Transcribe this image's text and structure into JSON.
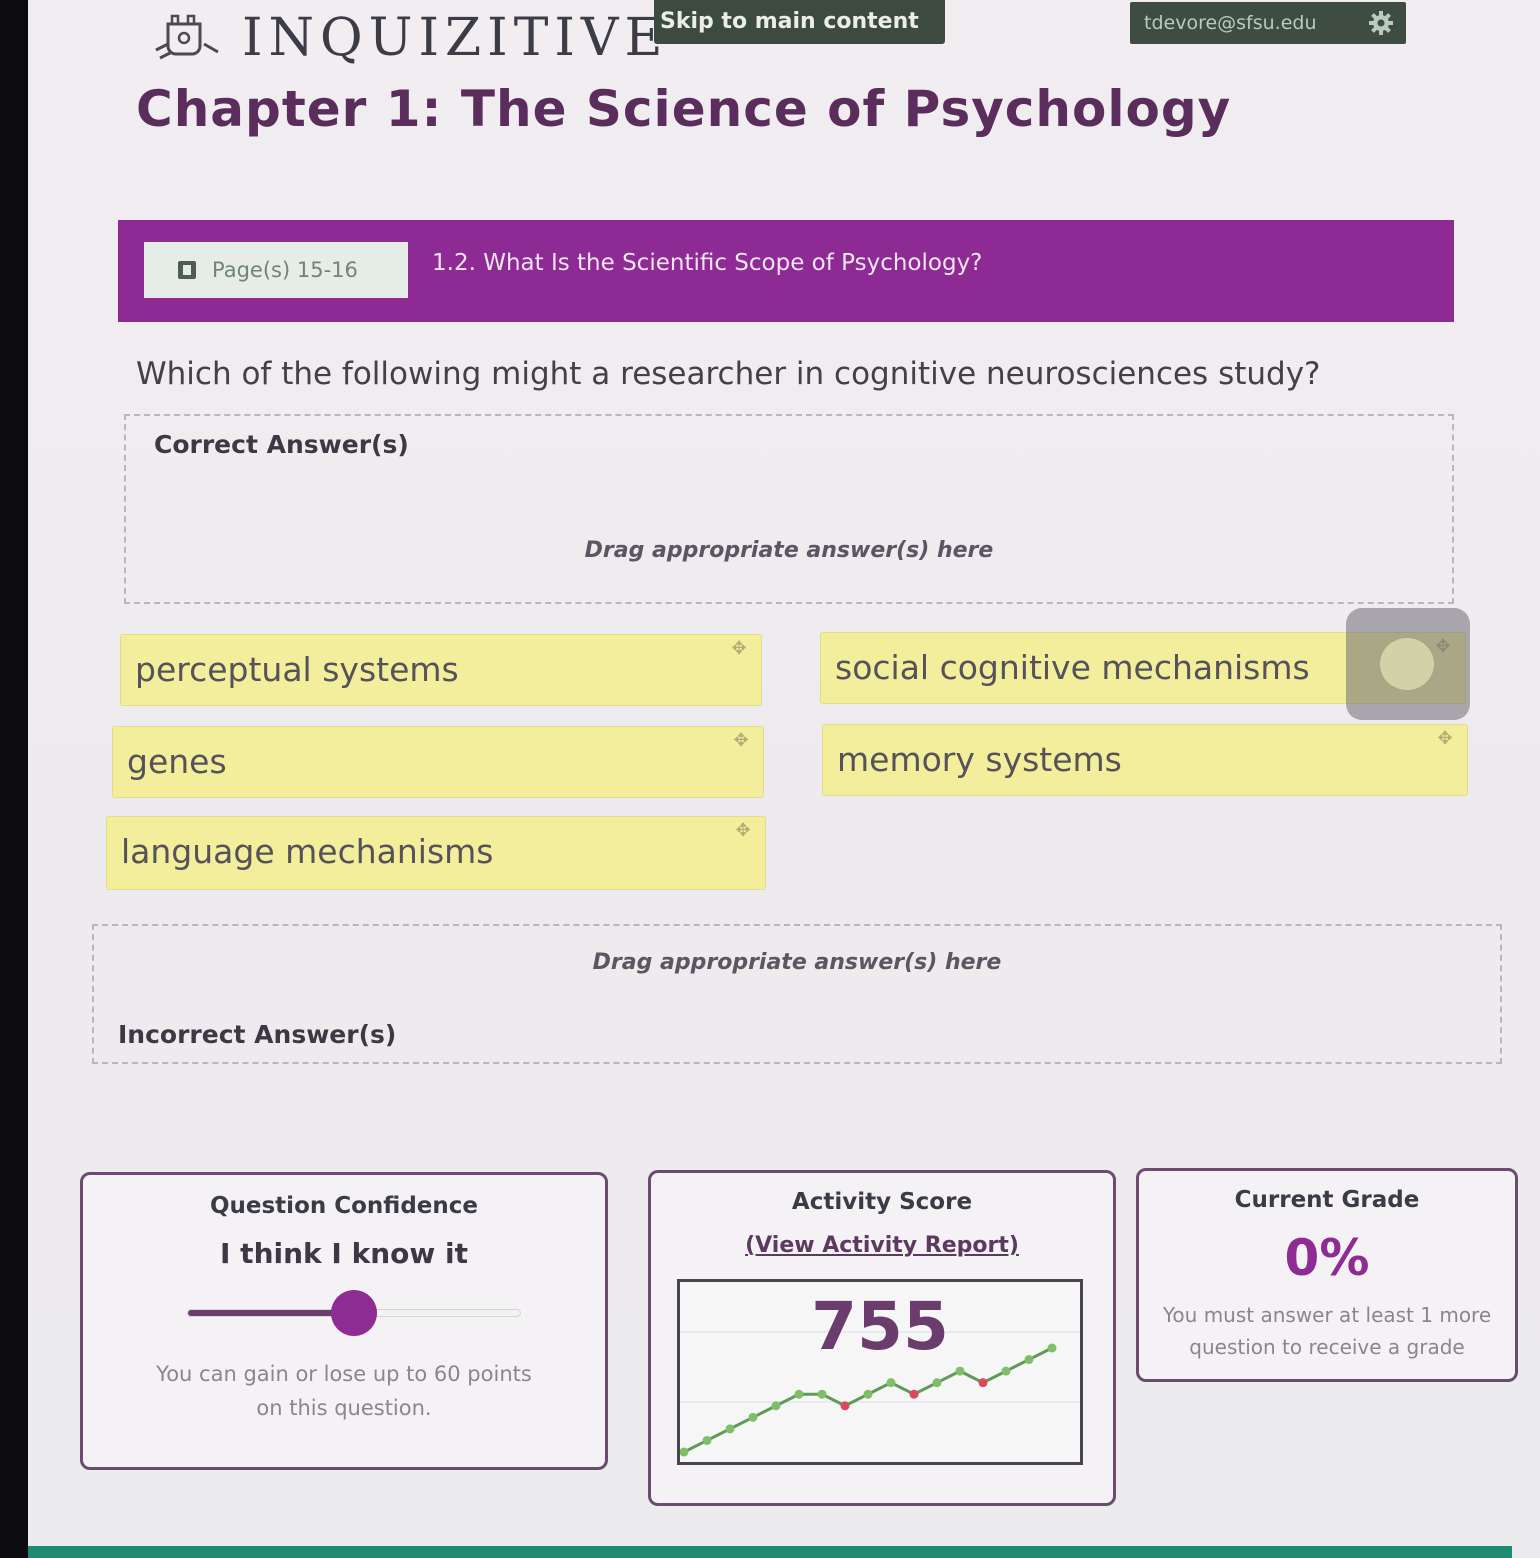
{
  "header": {
    "logo_text": "INQUIZITIVE",
    "skip_link": "Skip to main content",
    "user_email": "tdevore@sfsu.edu"
  },
  "chapter": {
    "title": "Chapter 1: The Science of Psychology"
  },
  "banner": {
    "page_ref": "Page(s) 15-16",
    "section_title": "1.2. What Is the Scientific Scope of Psychology?"
  },
  "question": {
    "text": "Which of the following might a researcher in cognitive neurosciences study?"
  },
  "correct_zone": {
    "label": "Correct Answer(s)",
    "hint": "Drag appropriate answer(s) here"
  },
  "incorrect_zone": {
    "label": "Incorrect Answer(s)",
    "hint": "Drag appropriate answer(s) here"
  },
  "answers": [
    "perceptual systems",
    "social cognitive mechanisms",
    "genes",
    "memory systems",
    "language mechanisms"
  ],
  "confidence": {
    "title": "Question Confidence",
    "value": "I think I know it",
    "level": 0.5,
    "note": "You can gain or lose up to 60 points on this question."
  },
  "activity": {
    "title": "Activity Score",
    "link": "(View Activity Report)",
    "score": "755",
    "trend": [
      {
        "v": 0,
        "ok": true
      },
      {
        "v": 1,
        "ok": true
      },
      {
        "v": 2,
        "ok": true
      },
      {
        "v": 3,
        "ok": true
      },
      {
        "v": 4,
        "ok": true
      },
      {
        "v": 5,
        "ok": true
      },
      {
        "v": 5,
        "ok": true
      },
      {
        "v": 4,
        "ok": false
      },
      {
        "v": 5,
        "ok": true
      },
      {
        "v": 6,
        "ok": true
      },
      {
        "v": 5,
        "ok": false
      },
      {
        "v": 6,
        "ok": true
      },
      {
        "v": 7,
        "ok": true
      },
      {
        "v": 6,
        "ok": false
      },
      {
        "v": 7,
        "ok": true
      },
      {
        "v": 8,
        "ok": true
      },
      {
        "v": 9,
        "ok": true
      }
    ],
    "colors": {
      "correct": "#7fbf6a",
      "incorrect": "#d84a5c",
      "line": "#5f9a58"
    }
  },
  "grade": {
    "title": "Current Grade",
    "value": "0%",
    "note": "You must answer at least 1 more question to receive a grade"
  }
}
